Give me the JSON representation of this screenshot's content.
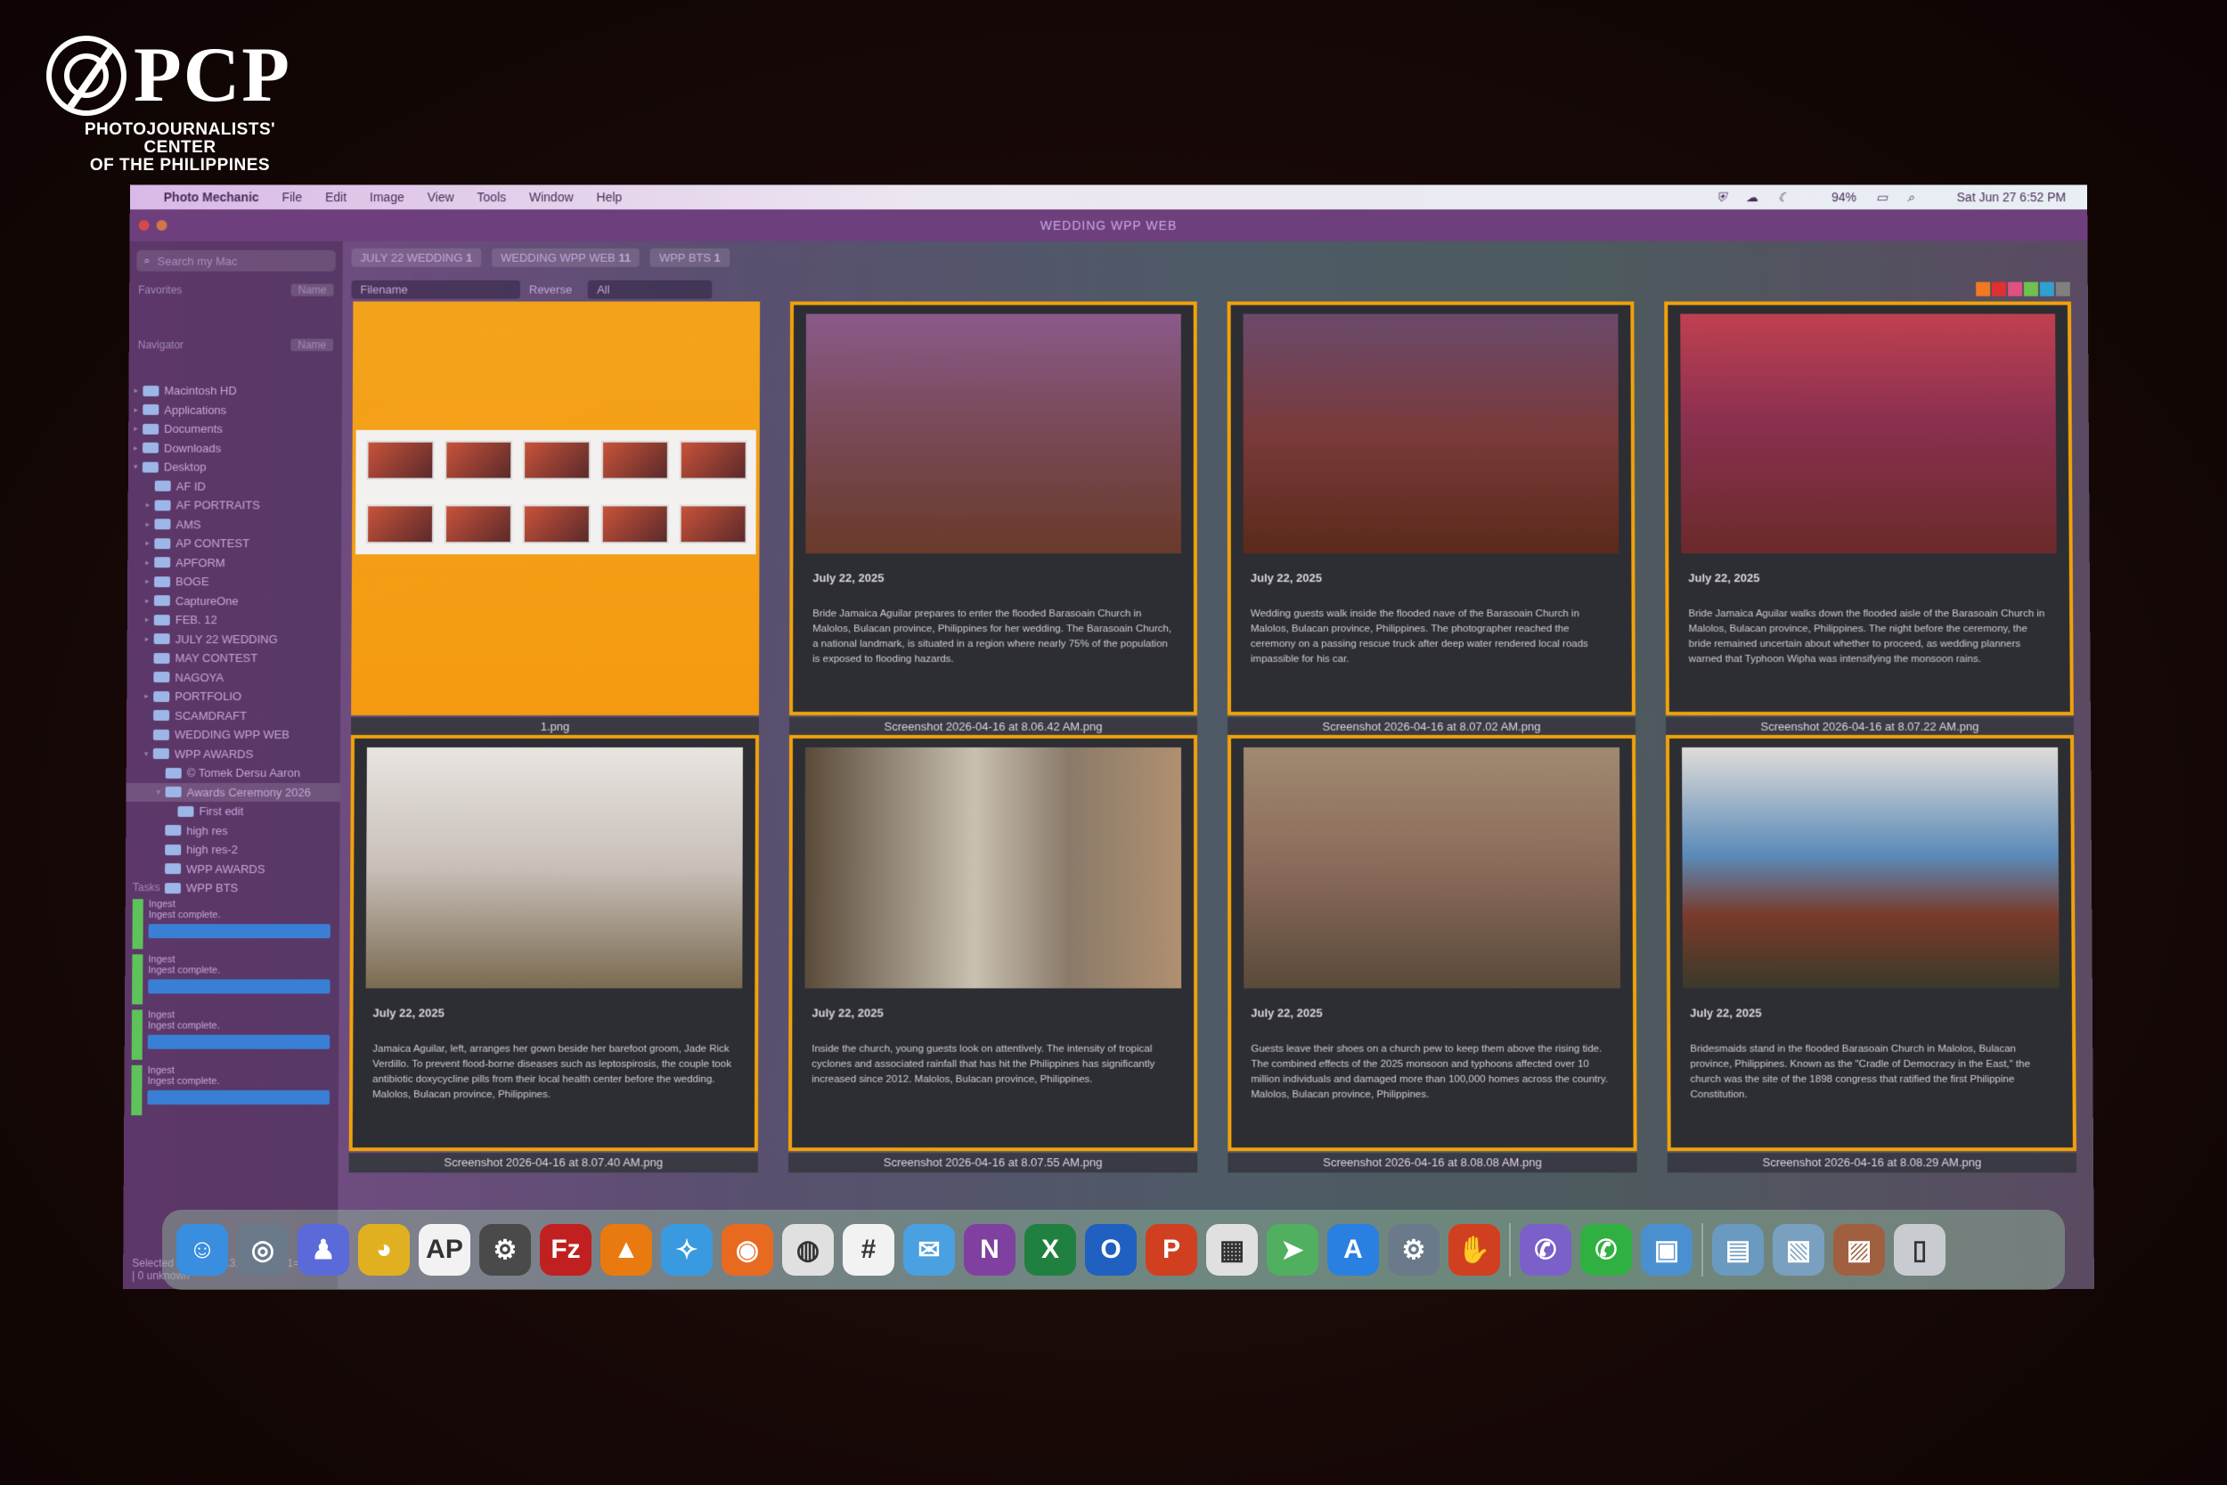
{
  "logo": {
    "mark": "PCP",
    "subtitle_line1": "PHOTOJOURNALISTS' CENTER",
    "subtitle_line2": "OF THE PHILIPPINES"
  },
  "menubar": {
    "apple": "",
    "items": [
      "Photo Mechanic",
      "File",
      "Edit",
      "Image",
      "View",
      "Tools",
      "Window",
      "Help"
    ],
    "battery": "94%",
    "clock": "Sat Jun 27  6:52 PM"
  },
  "window": {
    "title": "WEDDING WPP WEB"
  },
  "sidebar": {
    "search_placeholder": "Search my Mac",
    "favorites_label": "Favorites",
    "navigator_label": "Navigator",
    "name_button": "Name",
    "tree": [
      {
        "label": "Macintosh HD",
        "depth": 0,
        "tri": "▸"
      },
      {
        "label": "Applications",
        "depth": 0,
        "tri": "▸"
      },
      {
        "label": "Documents",
        "depth": 0,
        "tri": "▸"
      },
      {
        "label": "Downloads",
        "depth": 0,
        "tri": "▸"
      },
      {
        "label": "Desktop",
        "depth": 0,
        "tri": "▾"
      },
      {
        "label": "AF ID",
        "depth": 1,
        "tri": ""
      },
      {
        "label": "AF PORTRAITS",
        "depth": 1,
        "tri": "▸"
      },
      {
        "label": "AMS",
        "depth": 1,
        "tri": "▸"
      },
      {
        "label": "AP CONTEST",
        "depth": 1,
        "tri": "▸"
      },
      {
        "label": "APFORM",
        "depth": 1,
        "tri": "▸"
      },
      {
        "label": "BOGE",
        "depth": 1,
        "tri": "▸"
      },
      {
        "label": "CaptureOne",
        "depth": 1,
        "tri": "▸"
      },
      {
        "label": "FEB. 12",
        "depth": 1,
        "tri": "▸"
      },
      {
        "label": "JULY 22 WEDDING",
        "depth": 1,
        "tri": "▸"
      },
      {
        "label": "MAY CONTEST",
        "depth": 1,
        "tri": ""
      },
      {
        "label": "NAGOYA",
        "depth": 1,
        "tri": ""
      },
      {
        "label": "PORTFOLIO",
        "depth": 1,
        "tri": "▸"
      },
      {
        "label": "SCAMDRAFT",
        "depth": 1,
        "tri": ""
      },
      {
        "label": "WEDDING WPP WEB",
        "depth": 1,
        "tri": ""
      },
      {
        "label": "WPP AWARDS",
        "depth": 1,
        "tri": "▾"
      },
      {
        "label": "© Tomek Dersu Aaron",
        "depth": 2,
        "tri": ""
      },
      {
        "label": "Awards Ceremony 2026",
        "depth": 2,
        "tri": "▾",
        "selected": true
      },
      {
        "label": "First edit",
        "depth": 3,
        "tri": ""
      },
      {
        "label": "high res",
        "depth": 2,
        "tri": ""
      },
      {
        "label": "high res-2",
        "depth": 2,
        "tri": ""
      },
      {
        "label": "WPP AWARDS",
        "depth": 2,
        "tri": ""
      },
      {
        "label": "WPP BTS",
        "depth": 2,
        "tri": ""
      }
    ],
    "tasks_label": "Tasks",
    "tasks": [
      {
        "name": "Ingest",
        "status": "Ingest complete."
      },
      {
        "name": "Ingest",
        "status": "Ingest complete."
      },
      {
        "name": "Ingest",
        "status": "Ingest complete."
      },
      {
        "name": "Ingest",
        "status": "Ingest complete."
      }
    ],
    "status": "Selected 11 of 11 (4.31MB) | 0+11=11 total | 0 unknown"
  },
  "tabs": [
    "JULY 22 WEDDING",
    "WEDDING WPP WEB",
    "WPP BTS"
  ],
  "tab_counts": [
    "1",
    "11",
    "1"
  ],
  "toolbar": {
    "sort": "Filename",
    "reverse": "Reverse",
    "filter": "All"
  },
  "colors": {
    "frame": "#f1a20a",
    "accent": "#6e3f7d"
  },
  "cells": [
    {
      "type": "sheet",
      "filename": "1.png"
    },
    {
      "date": "July 22, 2025",
      "caption": "Bride Jamaica Aguilar prepares to enter the flooded Barasoain Church in Malolos, Bulacan province, Philippines for her wedding. The Barasoain Church, a national landmark, is situated in a region where nearly 75% of the population is exposed to flooding hazards.",
      "filename": "Screenshot 2026-04-16 at 8.06.42 AM.png"
    },
    {
      "date": "July 22, 2025",
      "caption": "Wedding guests walk inside the flooded nave of the Barasoain Church in Malolos, Bulacan province, Philippines. The photographer reached the ceremony on a passing rescue truck after deep water rendered local roads impassible for his car.",
      "filename": "Screenshot 2026-04-16 at 8.07.02 AM.png"
    },
    {
      "date": "July 22, 2025",
      "caption": "Bride Jamaica Aguilar walks down the flooded aisle of the Barasoain Church in Malolos, Bulacan province, Philippines. The night before the ceremony, the bride remained uncertain about whether to proceed, as wedding planners warned that Typhoon Wipha was intensifying the monsoon rains.",
      "filename": "Screenshot 2026-04-16 at 8.07.22 AM.png"
    },
    {
      "date": "July 22, 2025",
      "caption": "Jamaica Aguilar, left, arranges her gown beside her barefoot groom, Jade Rick Verdillo. To prevent flood-borne diseases such as leptospirosis, the couple took antibiotic doxycycline pills from their local health center before the wedding. Malolos, Bulacan province, Philippines.",
      "filename": "Screenshot 2026-04-16 at 8.07.40 AM.png"
    },
    {
      "date": "July 22, 2025",
      "caption": "Inside the church, young guests look on attentively. The intensity of tropical cyclones and associated rainfall that has hit the Philippines has significantly increased since 2012. Malolos, Bulacan province, Philippines.",
      "filename": "Screenshot 2026-04-16 at 8.07.55 AM.png"
    },
    {
      "date": "July 22, 2025",
      "caption": "Guests leave their shoes on a church pew to keep them above the rising tide. The combined effects of the 2025 monsoon and typhoons affected over 10 million individuals and damaged more than 100,000 homes across the country. Malolos, Bulacan province, Philippines.",
      "filename": "Screenshot 2026-04-16 at 8.08.08 AM.png"
    },
    {
      "date": "July 22, 2025",
      "caption": "Bridesmaids stand in the flooded Barasoain Church in Malolos, Bulacan province, Philippines. Known as the \"Cradle of Democracy in the East,\" the church was the site of the 1898 congress that ratified the first Philippine Constitution.",
      "filename": "Screenshot 2026-04-16 at 8.08.29 AM.png"
    }
  ],
  "dock": [
    {
      "name": "finder-icon",
      "glyph": "☺",
      "color": "#3a8ee0"
    },
    {
      "name": "siri-icon",
      "glyph": "◎",
      "color": "#6a7a8a"
    },
    {
      "name": "teams-icon",
      "glyph": "♟",
      "color": "#5a6ad8"
    },
    {
      "name": "cyberduck-icon",
      "glyph": "◕",
      "color": "#e0b020"
    },
    {
      "name": "ap-icon",
      "glyph": "AP",
      "color": "#f2f2f2"
    },
    {
      "name": "settings-gear-icon",
      "glyph": "⚙",
      "color": "#4a4a4a"
    },
    {
      "name": "filezilla-icon",
      "glyph": "Fz",
      "color": "#c02020"
    },
    {
      "name": "vlc-icon",
      "glyph": "▲",
      "color": "#e87a10"
    },
    {
      "name": "safari-icon",
      "glyph": "✧",
      "color": "#3a9ae0"
    },
    {
      "name": "firefox-icon",
      "glyph": "◉",
      "color": "#e86a20"
    },
    {
      "name": "chrome-icon",
      "glyph": "◍",
      "color": "#e0e0e0"
    },
    {
      "name": "slack-icon",
      "glyph": "#",
      "color": "#f2f2f2"
    },
    {
      "name": "mail-icon",
      "glyph": "✉",
      "color": "#4aa0e0"
    },
    {
      "name": "onenote-icon",
      "glyph": "N",
      "color": "#8040a0"
    },
    {
      "name": "excel-icon",
      "glyph": "X",
      "color": "#208040"
    },
    {
      "name": "outlook-icon",
      "glyph": "O",
      "color": "#2060c0"
    },
    {
      "name": "powerpoint-icon",
      "glyph": "P",
      "color": "#d04020"
    },
    {
      "name": "launchpad-icon",
      "glyph": "▦",
      "color": "#e0e0e0"
    },
    {
      "name": "maps-icon",
      "glyph": "➤",
      "color": "#50b060"
    },
    {
      "name": "app-store-icon",
      "glyph": "A",
      "color": "#2a80e0"
    },
    {
      "name": "system-settings-icon",
      "glyph": "⚙",
      "color": "#6a7a8a"
    },
    {
      "name": "photo-mechanic-icon",
      "glyph": "✋",
      "color": "#d04020"
    },
    {
      "name": "viber-icon",
      "glyph": "✆",
      "color": "#7a60c8"
    },
    {
      "name": "whatsapp-icon",
      "glyph": "✆",
      "color": "#30b040"
    },
    {
      "name": "preview-icon",
      "glyph": "▣",
      "color": "#4a90d0"
    },
    {
      "name": "downloads-folder-icon",
      "glyph": "▤",
      "color": "#6a9ac0"
    },
    {
      "name": "photos-folder-icon",
      "glyph": "▧",
      "color": "#7aa0c0"
    },
    {
      "name": "image-stack-icon",
      "glyph": "▨",
      "color": "#a06040"
    },
    {
      "name": "trash-icon",
      "glyph": "▯",
      "color": "#c8ccd0"
    }
  ]
}
